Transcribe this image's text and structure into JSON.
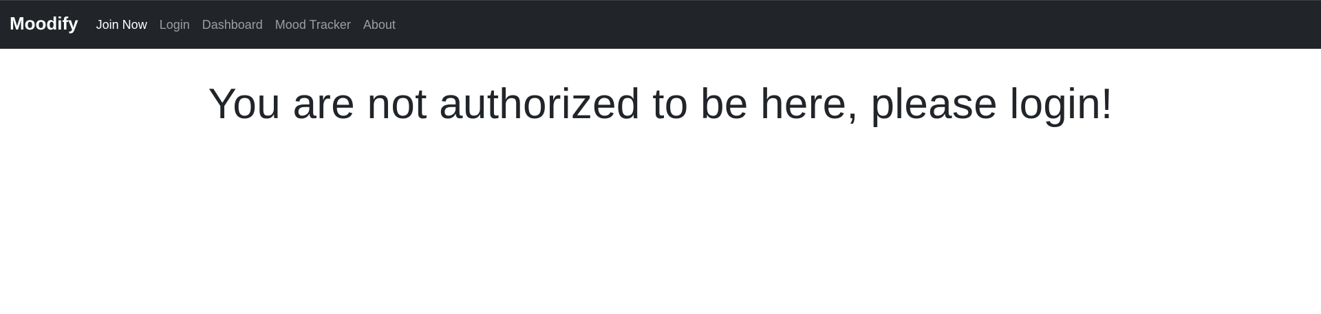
{
  "navbar": {
    "brand": "Moodify",
    "links": [
      {
        "label": "Join Now",
        "active": true
      },
      {
        "label": "Login",
        "active": false
      },
      {
        "label": "Dashboard",
        "active": false
      },
      {
        "label": "Mood Tracker",
        "active": false
      },
      {
        "label": "About",
        "active": false
      }
    ]
  },
  "main": {
    "message": "You are not authorized to be here, please login!"
  },
  "colors": {
    "navbar_bg": "#212529",
    "text_dark": "#212529",
    "link_muted": "rgba(255,255,255,0.55)",
    "link_active": "#ffffff"
  }
}
